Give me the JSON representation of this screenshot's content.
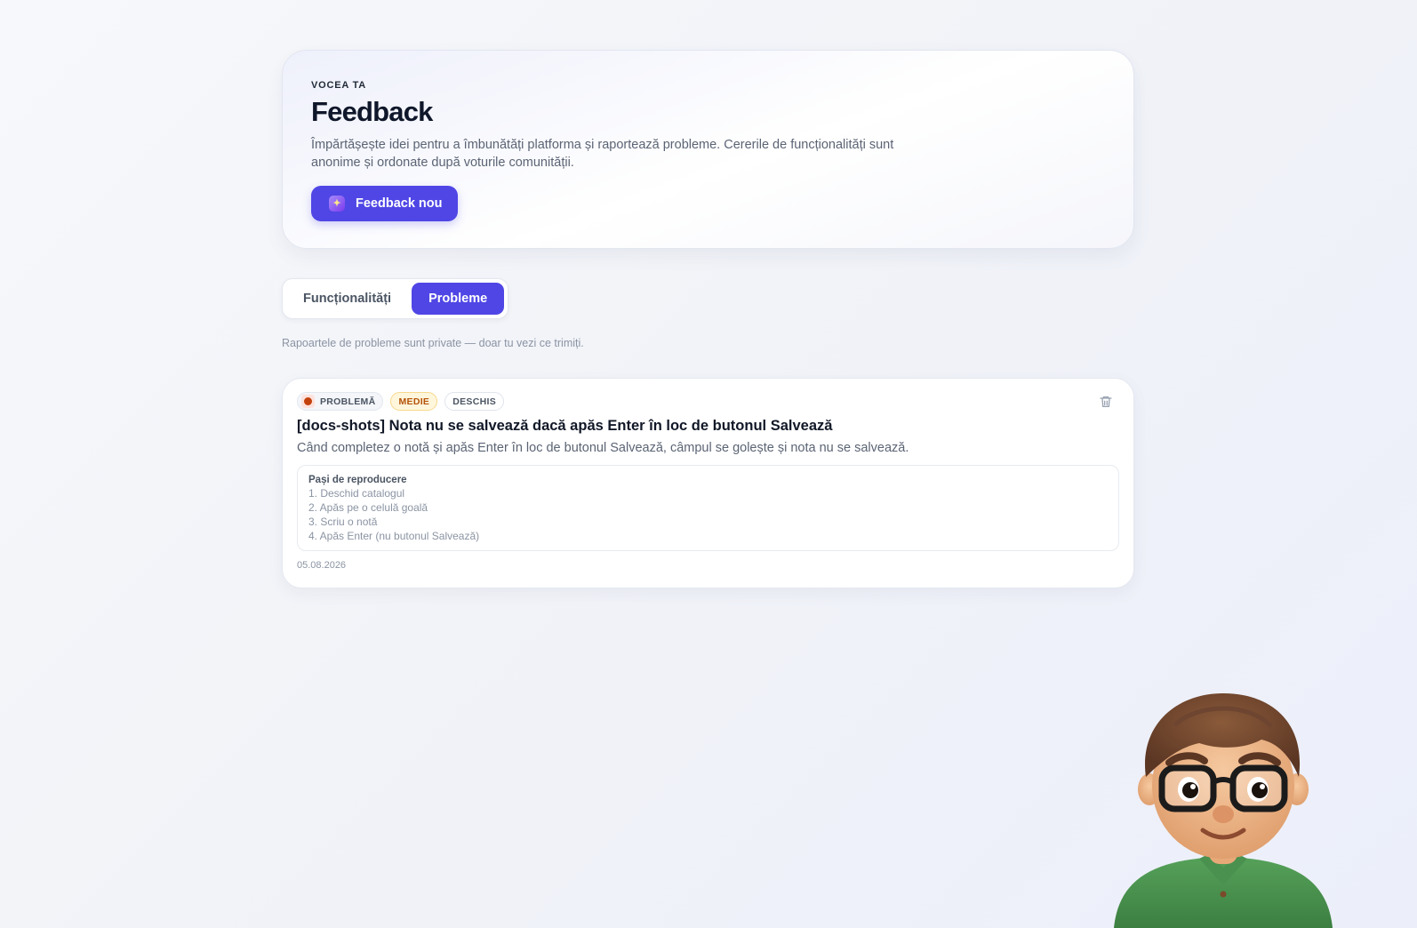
{
  "hero": {
    "eyebrow": "VOCEA TA",
    "title": "Feedback",
    "subtitle": "Împărtășește idei pentru a îmbunătăți platforma și raportează probleme. Cererile de funcționalități sunt anonime și ordonate după voturile comunității.",
    "new_button_label": "Feedback nou",
    "new_button_icon": "lightbulb-icon"
  },
  "tabs": [
    {
      "label": "Funcționalități",
      "active": false
    },
    {
      "label": "Probleme",
      "active": true
    }
  ],
  "tab_note": "Rapoartele de probleme sunt private — doar tu vezi ce trimiți.",
  "issue": {
    "type_badge": "PROBLEMĂ",
    "type_icon": "bug-icon",
    "severity_badge": "MEDIE",
    "status_badge": "DESCHIS",
    "title": "[docs-shots] Nota nu se salvează dacă apăs Enter în loc de butonul Salvează",
    "description": "Când completez o notă și apăs Enter în loc de butonul Salvează, câmpul se golește și nota nu se salvează.",
    "steps_label": "Pași de reproducere",
    "steps": [
      "1. Deschid catalogul",
      "2. Apăs pe o celulă goală",
      "3. Scriu o notă",
      "4. Apăs Enter (nu butonul Salvează)"
    ],
    "date": "05.08.2026",
    "delete_icon": "trash-icon"
  },
  "colors": {
    "accent": "#4f46e5",
    "severity_text": "#b45309",
    "severity_bg": "#fff6dc"
  }
}
